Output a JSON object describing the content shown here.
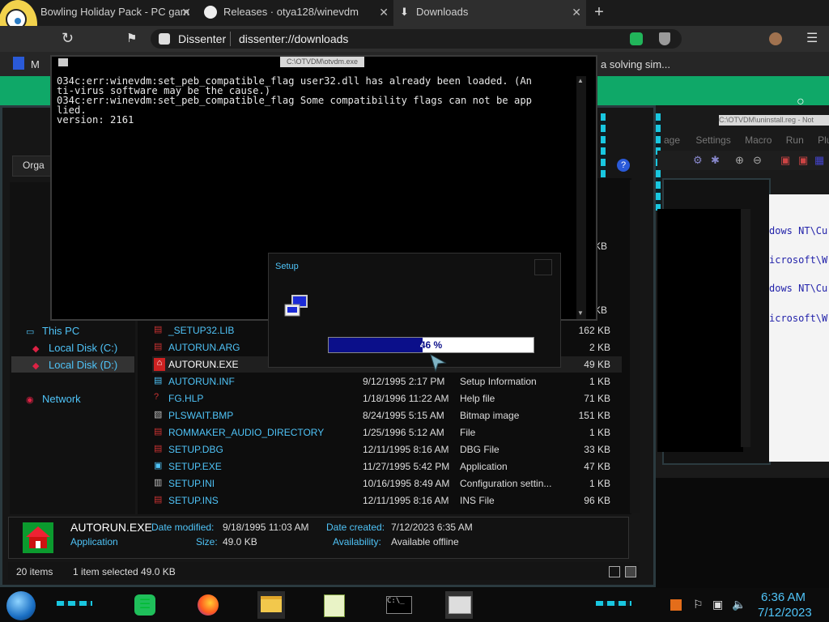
{
  "browser": {
    "tabs": [
      {
        "title": "Bowling Holiday Pack - PC gam",
        "icon": "mascot-icon"
      },
      {
        "title": "Releases · otya128/winevdm",
        "icon": "github-icon"
      },
      {
        "title": "Downloads",
        "icon": "download-icon",
        "active": true
      }
    ],
    "address": {
      "site": "Dissenter",
      "url": "dissenter://downloads"
    },
    "bookmark_partial": "a solving sim...",
    "bookmark_left": "M"
  },
  "console": {
    "title": "C:\\OTVDM\\otvdm.exe",
    "lines": [
      "034c:err:winevdm:set_peb_compatible_flag user32.dll has already been loaded. (An",
      "ti-virus software may be the cause.)",
      "034c:err:winevdm:set_peb_compatible_flag Some compatibility flags can not be app",
      "lied.",
      "version: 2161"
    ]
  },
  "setup": {
    "title": "Setup",
    "progress_percent": 46,
    "progress_label": "46 %"
  },
  "explorer": {
    "organize": "Orga",
    "nav": {
      "this_pc": "This PC",
      "disk_c": "Local Disk (C:)",
      "disk_d": "Local Disk (D:)",
      "network": "Network"
    },
    "size_column_partial": [
      "KB",
      "KB"
    ],
    "files": [
      {
        "name": "_SETUP32.LIB",
        "date": "",
        "type": "",
        "size": "162 KB"
      },
      {
        "name": "AUTORUN.ARG",
        "date": "",
        "type": "",
        "size": "2 KB"
      },
      {
        "name": "AUTORUN.EXE",
        "date": "",
        "type": "",
        "size": "49 KB",
        "selected": true
      },
      {
        "name": "AUTORUN.INF",
        "date": "9/12/1995 2:17 PM",
        "type": "Setup Information",
        "size": "1 KB"
      },
      {
        "name": "FG.HLP",
        "date": "1/18/1996 11:22 AM",
        "type": "Help file",
        "size": "71 KB"
      },
      {
        "name": "PLSWAIT.BMP",
        "date": "8/24/1995 5:15 AM",
        "type": "Bitmap image",
        "size": "151 KB"
      },
      {
        "name": "ROMMAKER_AUDIO_DIRECTORY",
        "date": "1/25/1996 5:12 AM",
        "type": "File",
        "size": "1 KB"
      },
      {
        "name": "SETUP.DBG",
        "date": "12/11/1995 8:16 AM",
        "type": "DBG File",
        "size": "33 KB"
      },
      {
        "name": "SETUP.EXE",
        "date": "11/27/1995 5:42 PM",
        "type": "Application",
        "size": "47 KB"
      },
      {
        "name": "SETUP.INI",
        "date": "10/16/1995 8:49 AM",
        "type": "Configuration settin...",
        "size": "1 KB"
      },
      {
        "name": "SETUP.INS",
        "date": "12/11/1995 8:16 AM",
        "type": "INS File",
        "size": "96 KB"
      }
    ],
    "details": {
      "name": "AUTORUN.EXE",
      "kind": "Application",
      "date_modified_label": "Date modified:",
      "date_modified": "9/18/1995 11:03 AM",
      "size_label": "Size:",
      "size": "49.0 KB",
      "date_created_label": "Date created:",
      "date_created": "7/12/2023 6:35 AM",
      "availability_label": "Availability:",
      "availability": "Available offline"
    },
    "status": {
      "items": "20 items",
      "selected": "1 item selected  49.0 KB"
    }
  },
  "notepad": {
    "title": "C:\\OTVDM\\uninstall.reg - Not",
    "menu": [
      "age",
      "Settings",
      "Macro",
      "Run",
      "Plu"
    ],
    "lines": [
      "dows NT\\Cu",
      "icrosoft\\W",
      "dows NT\\Cu",
      "icrosoft\\W"
    ]
  },
  "taskbar": {
    "time": "6:36 AM",
    "date": "7/12/2023"
  },
  "colors": {
    "accent_cyan": "#19c7e0",
    "link_blue": "#4fc3f7",
    "progress_navy": "#0b0f8a",
    "browser_green": "#0fa868"
  }
}
